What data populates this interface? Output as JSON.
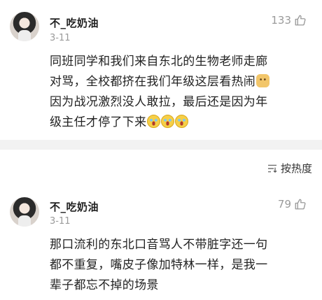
{
  "comments": [
    {
      "username": "不_吃奶油",
      "date": "3-11",
      "likes": "133",
      "lines": [
        "同班同学和我们来自东北的生物老师走廊",
        "对骂，全校都挤在我们年级这层看热闹",
        "因为战况激烈没人敢拉，最后还是因为年",
        "级主任才停了下来"
      ]
    },
    {
      "username": "不_吃奶油",
      "date": "3-11",
      "likes": "79",
      "lines": [
        "那口流利的东北口音骂人不带脏字还一句",
        "都不重复，嘴皮子像加特林一样，是我一",
        "辈子都忘不掉的场景"
      ]
    }
  ],
  "sort": {
    "label": "按热度"
  },
  "icons": {
    "like": "thumbs-up-icon",
    "sort": "sort-icon",
    "emoji_dog": "doge-emoji",
    "emoji_laugh": "laugh-cry-emoji"
  }
}
